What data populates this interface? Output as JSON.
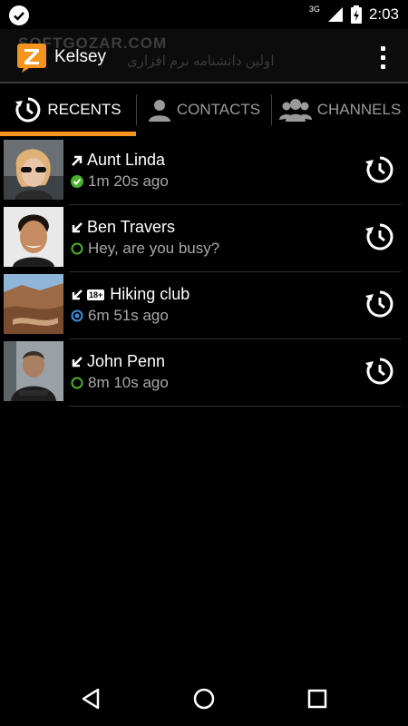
{
  "status_bar": {
    "network": "3G",
    "time": "2:03"
  },
  "app_bar": {
    "title": "Kelsey",
    "watermark": "SOFTGOZAR.COM",
    "watermark_sub": "اولین دانشنامه نرم افزاری"
  },
  "tabs": [
    {
      "label": "RECENTS",
      "icon": "recents-clock-icon",
      "active": true
    },
    {
      "label": "CONTACTS",
      "icon": "person-icon",
      "active": false
    },
    {
      "label": "CHANNELS",
      "icon": "group-icon",
      "active": false
    }
  ],
  "recents": [
    {
      "name": "Aunt Linda",
      "direction": "outgoing",
      "status": "online",
      "status_text": "1m 20s ago",
      "badge": ""
    },
    {
      "name": "Ben Travers",
      "direction": "incoming",
      "status": "available",
      "status_text": "Hey, are you busy?",
      "badge": ""
    },
    {
      "name": "Hiking club",
      "direction": "incoming",
      "status": "channel",
      "status_text": "6m 51s ago",
      "badge": "18+"
    },
    {
      "name": "John Penn",
      "direction": "incoming",
      "status": "available",
      "status_text": "8m 10s ago",
      "badge": ""
    }
  ],
  "colors": {
    "accent": "#f7941d",
    "online": "#4caf2e",
    "channel": "#3b8fd8"
  }
}
